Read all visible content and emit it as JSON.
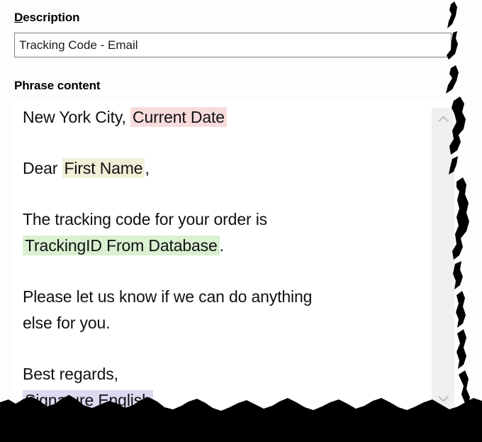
{
  "form": {
    "description": {
      "label_accel": "D",
      "label_rest": "escription",
      "value": "Tracking Code - Email",
      "placeholder": "Description"
    },
    "phrase": {
      "label": "Phrase content"
    }
  },
  "phrase_content": {
    "lines": [
      {
        "segments": [
          {
            "text": "New York City, ",
            "token": false
          },
          {
            "text": "Current Date",
            "token": true,
            "color": "#f8dcdc"
          }
        ]
      },
      {
        "spacer": true
      },
      {
        "segments": [
          {
            "text": "Dear ",
            "token": false
          },
          {
            "text": "First Name",
            "token": true,
            "color": "#f2efd9"
          },
          {
            "text": ",",
            "token": false
          }
        ]
      },
      {
        "spacer": true
      },
      {
        "segments": [
          {
            "text": "The tracking code for your order is",
            "token": false
          }
        ]
      },
      {
        "segments": [
          {
            "text": "TrackingID From Database",
            "token": true,
            "color": "#d9f0d1"
          },
          {
            "text": ".",
            "token": false
          }
        ]
      },
      {
        "spacer": true
      },
      {
        "segments": [
          {
            "text": "Please let us know if we can do anything",
            "token": false
          }
        ]
      },
      {
        "segments": [
          {
            "text": "else for you.",
            "token": false
          }
        ]
      },
      {
        "spacer": true
      },
      {
        "segments": [
          {
            "text": "Best regards,",
            "token": false
          }
        ]
      },
      {
        "segments": [
          {
            "text": "Signature English",
            "token": true,
            "color": "#dcdaf0"
          }
        ]
      }
    ]
  },
  "scrollbar": {
    "up_icon": "chevron-up-icon",
    "down_icon": "chevron-down-icon"
  },
  "colors": {
    "token_date": "#f8dcdc",
    "token_name": "#f2efd9",
    "token_tracking": "#d9f0d1",
    "token_signature": "#dcdaf0",
    "input_border": "#808080",
    "editor_background": "#ffffff",
    "page_background": "#fdfdfd",
    "torn_edge": "#000000"
  }
}
